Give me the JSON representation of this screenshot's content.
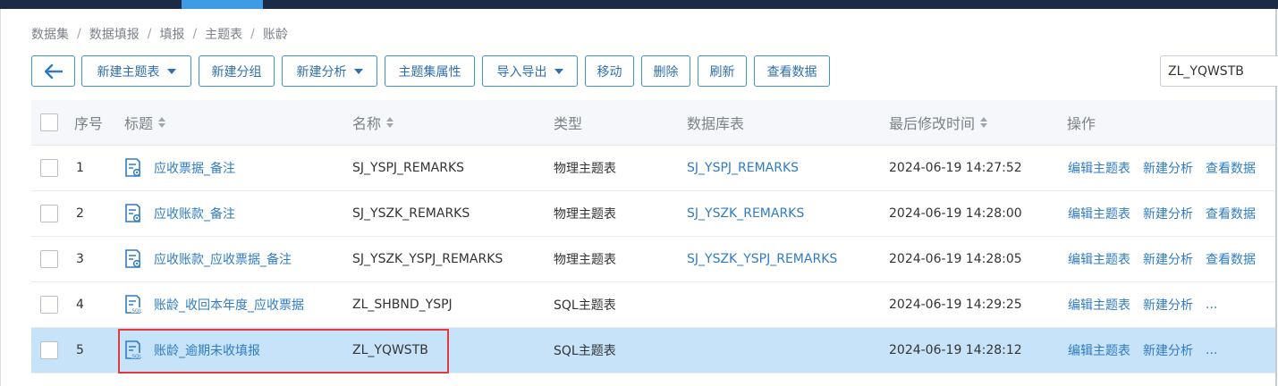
{
  "breadcrumb": [
    "数据集",
    "数据填报",
    "填报",
    "主题表",
    "账龄"
  ],
  "toolbar": {
    "back_icon": "arrow-left-icon",
    "buttons": [
      {
        "label": "新建主题表",
        "dropdown": true
      },
      {
        "label": "新建分组",
        "dropdown": false
      },
      {
        "label": "新建分析",
        "dropdown": true
      },
      {
        "label": "主题集属性",
        "dropdown": false
      },
      {
        "label": "导入导出",
        "dropdown": true
      },
      {
        "label": "移动",
        "dropdown": false
      },
      {
        "label": "删除",
        "dropdown": false
      },
      {
        "label": "刷新",
        "dropdown": false
      },
      {
        "label": "查看数据",
        "dropdown": false
      }
    ]
  },
  "search": {
    "value": "ZL_YQWSTB"
  },
  "table": {
    "headers": {
      "index": "序号",
      "title": "标题",
      "name": "名称",
      "type": "类型",
      "db_table": "数据库表",
      "modified": "最后修改时间",
      "actions": "操作"
    },
    "rows": [
      {
        "index": "1",
        "title": "应收票据_备注",
        "name": "SJ_YSPJ_REMARKS",
        "type": "物理主题表",
        "db_table": "SJ_YSPJ_REMARKS",
        "modified": "2024-06-19 14:27:52",
        "icon": "physical-table-icon",
        "actions": [
          "编辑主题表",
          "新建分析",
          "查看数据"
        ],
        "selected": false
      },
      {
        "index": "2",
        "title": "应收账款_备注",
        "name": "SJ_YSZK_REMARKS",
        "type": "物理主题表",
        "db_table": "SJ_YSZK_REMARKS",
        "modified": "2024-06-19 14:28:00",
        "icon": "physical-table-icon",
        "actions": [
          "编辑主题表",
          "新建分析",
          "查看数据"
        ],
        "selected": false
      },
      {
        "index": "3",
        "title": "应收账款_应收票据_备注",
        "name": "SJ_YSZK_YSPJ_REMARKS",
        "type": "物理主题表",
        "db_table": "SJ_YSZK_YSPJ_REMARKS",
        "modified": "2024-06-19 14:28:05",
        "icon": "physical-table-icon",
        "actions": [
          "编辑主题表",
          "新建分析",
          "查看数据"
        ],
        "selected": false
      },
      {
        "index": "4",
        "title": "账龄_收回本年度_应收票据",
        "name": "ZL_SHBND_YSPJ",
        "type": "SQL主题表",
        "db_table": "",
        "modified": "2024-06-19 14:29:25",
        "icon": "sql-table-icon",
        "actions": [
          "编辑主题表",
          "新建分析",
          "..."
        ],
        "selected": false
      },
      {
        "index": "5",
        "title": "账龄_逾期未收填报",
        "name": "ZL_YQWSTB",
        "type": "SQL主题表",
        "db_table": "",
        "modified": "2024-06-19 14:28:12",
        "icon": "sql-table-icon",
        "actions": [
          "编辑主题表",
          "新建分析",
          "..."
        ],
        "selected": true
      }
    ]
  },
  "colors": {
    "accent": "#2f7cc4",
    "selected_row": "#c7e3f9",
    "highlight_border": "#e23a3a"
  }
}
